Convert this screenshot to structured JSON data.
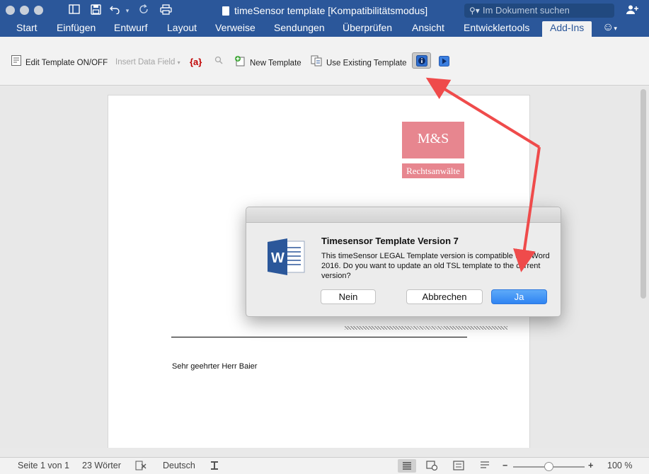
{
  "titlebar": {
    "title": "timeSensor template [Kompatibilitätsmodus]",
    "search_placeholder": "Im Dokument suchen"
  },
  "ribbon_tabs": [
    "Start",
    "Einfügen",
    "Entwurf",
    "Layout",
    "Verweise",
    "Sendungen",
    "Überprüfen",
    "Ansicht",
    "Entwicklertools",
    "Add-Ins"
  ],
  "active_tab": "Add-Ins",
  "addins_toolbar": {
    "edit_template": "Edit Template ON/OFF",
    "insert_data_field": "Insert Data Field",
    "field_glyph": "{a}",
    "new_template": "New Template",
    "use_existing": "Use Existing Template"
  },
  "document": {
    "logo_top": "M&S",
    "logo_bottom": "Rechtsanwälte",
    "salutation": "Sehr geehrter Herr Baier"
  },
  "dialog": {
    "title": "Timesensor Template Version 7",
    "message": "This timeSensor LEGAL Template version is compatible with Word 2016. Do you want to update an old TSL template to the current version?",
    "btn_no": "Nein",
    "btn_cancel": "Abbrechen",
    "btn_yes": "Ja"
  },
  "statusbar": {
    "page": "Seite 1 von 1",
    "words": "23 Wörter",
    "language": "Deutsch",
    "zoom": "100 %",
    "zoom_level": 0.5
  },
  "colors": {
    "word_blue": "#2b579a",
    "logo_pink": "#e7868f",
    "primary_button": "#2f84f2",
    "annotation_arrow": "#ef4b4b"
  }
}
